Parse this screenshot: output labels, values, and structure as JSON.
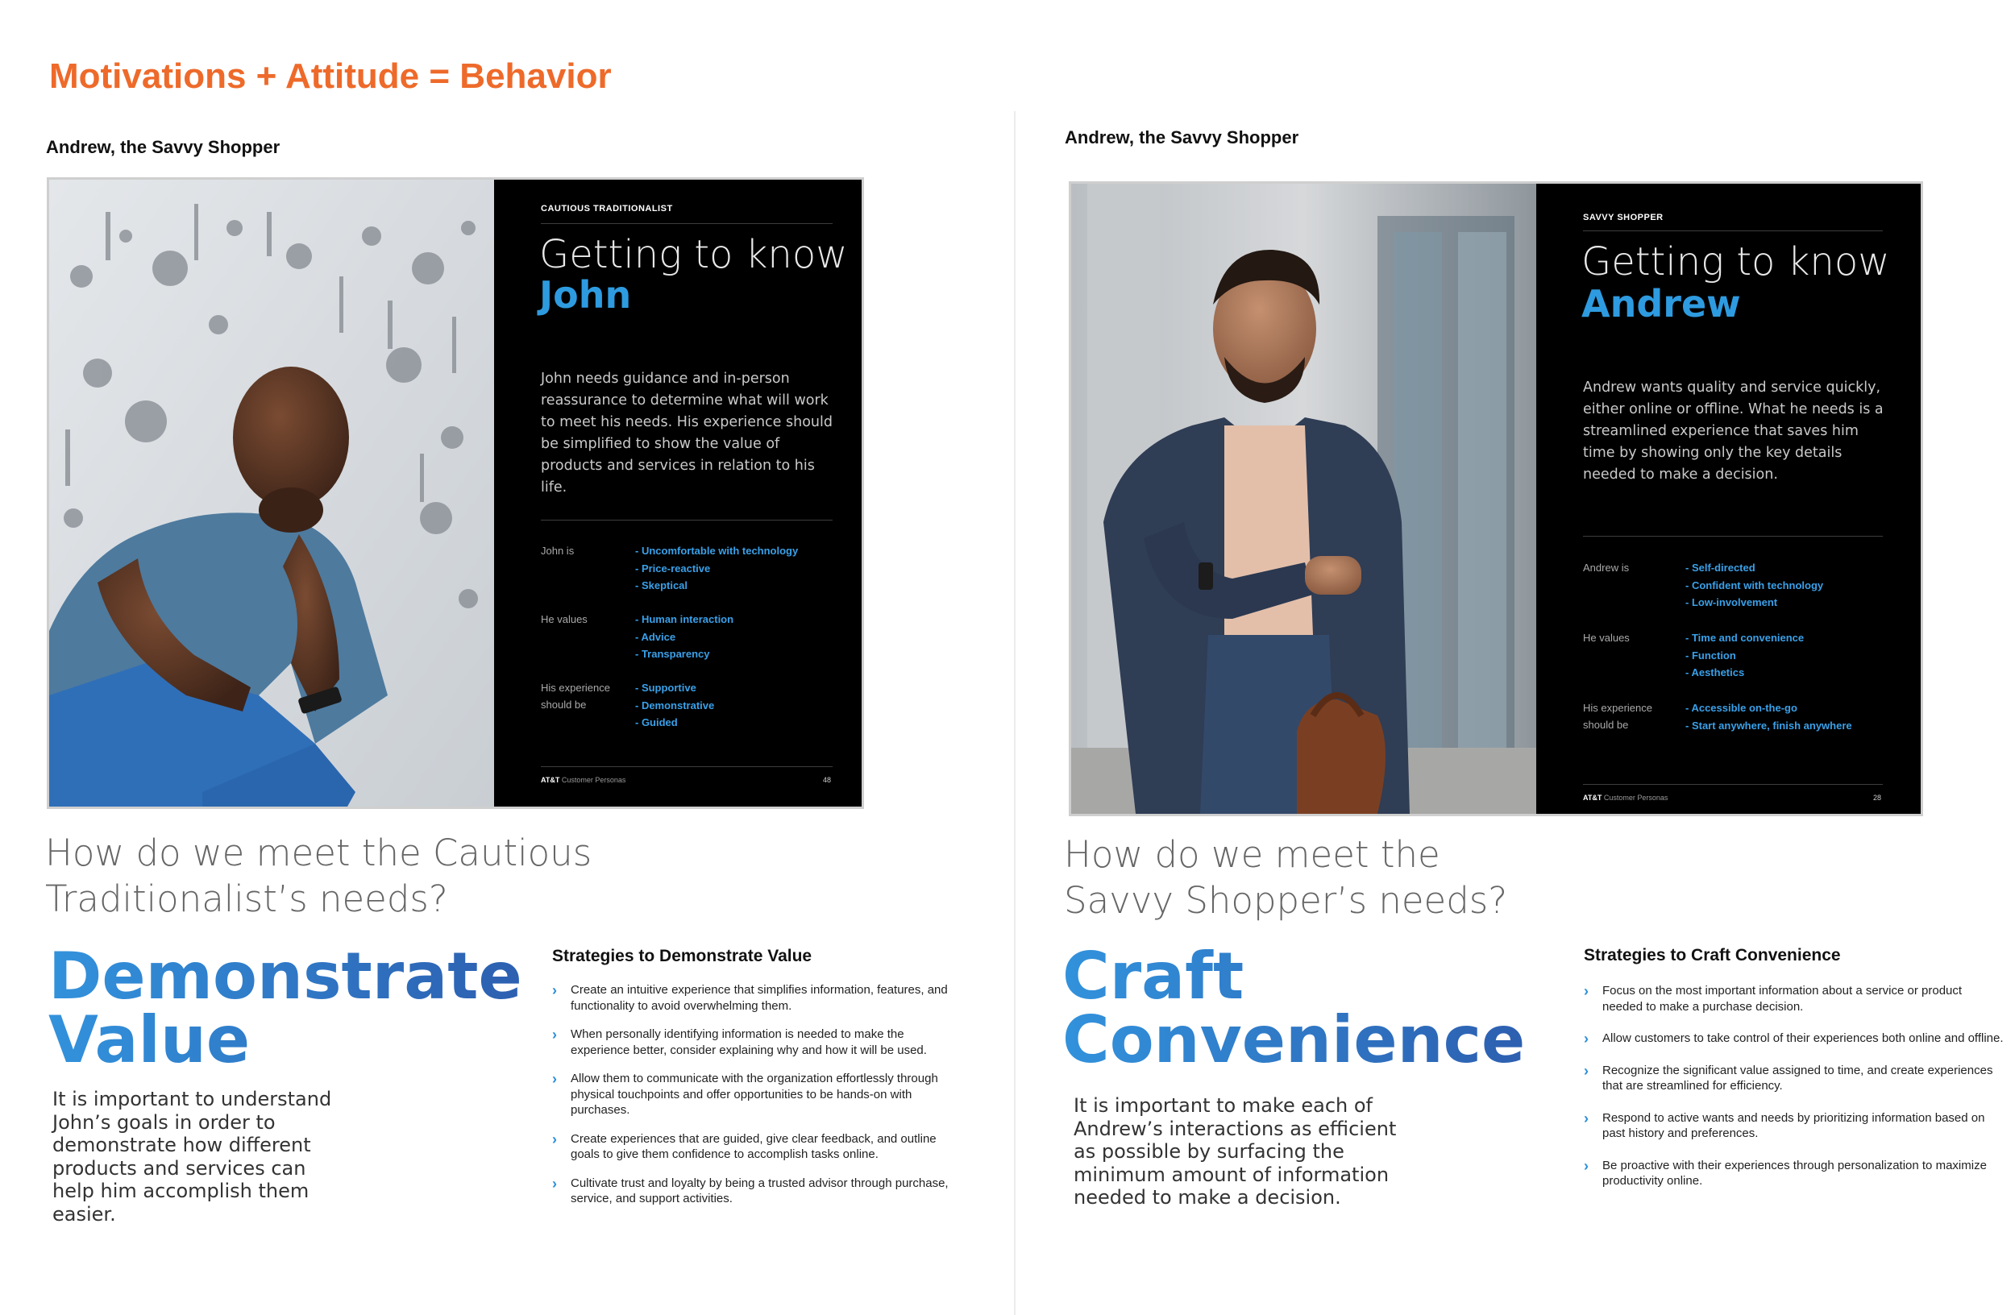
{
  "title": "Motivations + Attitude = Behavior",
  "personas": [
    {
      "label": "Andrew, the Savvy Shopper",
      "card": {
        "kicker": "CAUTIOUS TRADITIONALIST",
        "heading": "Getting to know",
        "name": "John",
        "description": "John needs guidance and in-person reassurance to determine what will work to meet his needs. His experience should be simplified to show the value of products and services in relation to his life.",
        "attributes": [
          {
            "key": "John is",
            "values": [
              "- Uncomfortable with technology",
              "- Price-reactive",
              "- Skeptical"
            ]
          },
          {
            "key": "He values",
            "values": [
              "- Human interaction",
              "- Advice",
              "- Transparency"
            ]
          },
          {
            "key": "His experience should be",
            "values": [
              "- Supportive",
              "- Demonstrative",
              "- Guided"
            ]
          }
        ],
        "footer_brand": "AT&T",
        "footer_text": "Customer Personas",
        "page_number": "48"
      },
      "question": "How do we meet the Cautious Traditionalist’s needs?",
      "headline_line1": "Demonstrate",
      "headline_line2": "Value",
      "paragraph": "It is important to understand John’s goals in order to demonstrate how different products and services can help him accomplish them easier.",
      "strategies_title": "Strategies to Demonstrate Value",
      "strategies": [
        "Create an intuitive experience that simplifies information, features, and functionality to avoid overwhelming them.",
        "When personally identifying information is needed to make the experience better, consider explaining why and how it will be used.",
        "Allow them to communicate with the organization effortlessly through physical touchpoints and offer opportunities to be hands-on with purchases.",
        "Create experiences that are guided, give clear feedback, and outline goals to give them confidence to accomplish tasks online.",
        "Cultivate trust and loyalty by being a trusted advisor through purchase, service, and support activities."
      ]
    },
    {
      "label": "Andrew, the Savvy Shopper",
      "card": {
        "kicker": "SAVVY SHOPPER",
        "heading": "Getting to know",
        "name": "Andrew",
        "description": "Andrew wants quality and service quickly, either online or offline. What he needs is a streamlined experience that saves him time by showing only the key details needed to make a decision.",
        "attributes": [
          {
            "key": "Andrew is",
            "values": [
              "- Self-directed",
              "- Confident with technology",
              "- Low-involvement"
            ]
          },
          {
            "key": "He values",
            "values": [
              "- Time and convenience",
              "- Function",
              "- Aesthetics"
            ]
          },
          {
            "key": "His experience should be",
            "values": [
              "- Accessible on-the-go",
              "- Start anywhere, finish anywhere"
            ]
          }
        ],
        "footer_brand": "AT&T",
        "footer_text": "Customer Personas",
        "page_number": "28"
      },
      "question": "How do we meet the Savvy Shopper’s needs?",
      "headline_line1": "Craft",
      "headline_line2": "Convenience",
      "paragraph": "It is important to make each of Andrew’s interactions as efficient as possible by surfacing the minimum amount of information needed to make a decision.",
      "strategies_title": "Strategies to Craft Convenience",
      "strategies": [
        "Focus on the most important information about a service or product needed to make a purchase decision.",
        "Allow customers to take control of their experiences both online and offline.",
        "Recognize the significant value assigned to time, and create experiences that are streamlined for efficiency.",
        "Respond to active wants and needs by prioritizing information based on past history and preferences.",
        "Be proactive with their experiences through personalization to maximize productivity online."
      ]
    }
  ],
  "colors": {
    "title_orange": "#ee6a2a",
    "accent_blue": "#2e9be0",
    "headline_blue_start": "#3292dc",
    "headline_blue_end": "#2d5fb0"
  }
}
